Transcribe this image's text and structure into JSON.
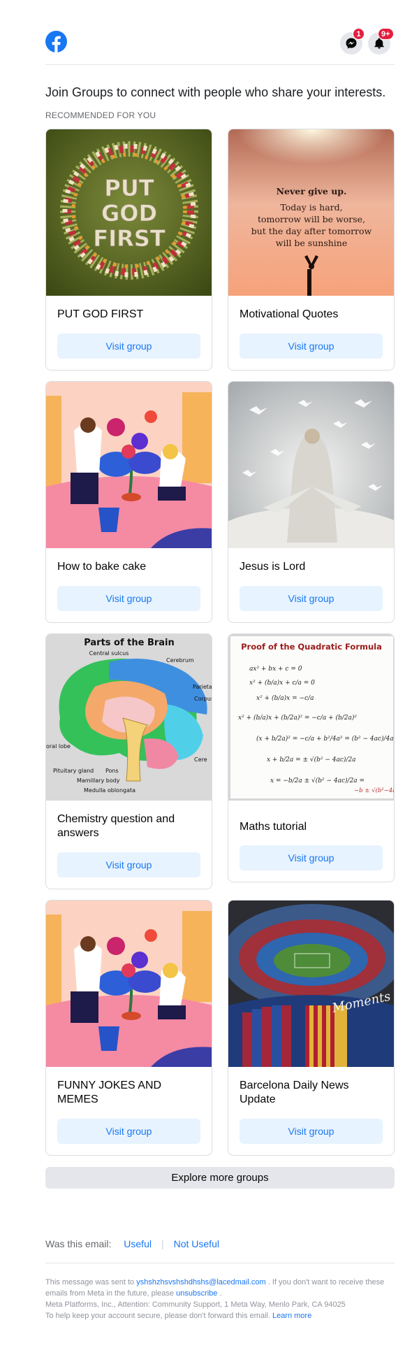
{
  "header": {
    "logo_icon": "facebook-logo-icon",
    "messenger_icon": "messenger-icon",
    "messenger_badge": "1",
    "notifications_icon": "bell-icon",
    "notifications_badge": "9+",
    "brand_color": "#1877f2",
    "badge_color": "#e41e3f"
  },
  "intro": "Join Groups to connect with people who share your interests.",
  "section_label": "RECOMMENDED FOR YOU",
  "groups": [
    {
      "name": "PUT GOD FIRST",
      "button": "Visit group",
      "image_text": [
        "PUT",
        "GOD",
        "FIRST"
      ]
    },
    {
      "name": "Motivational Quotes",
      "button": "Visit group",
      "image_text": [
        "Never give up.",
        "Today is hard,",
        "tomorrow will be worse,",
        "but the day after tomorrow",
        "will be sunshine"
      ]
    },
    {
      "name": "How to bake cake",
      "button": "Visit group"
    },
    {
      "name": "Jesus is Lord",
      "button": "Visit group"
    },
    {
      "name": "Chemistry question and answers",
      "button": "Visit group",
      "image_text": [
        "Parts of the Brain",
        "Central sulcus",
        "Cerebrum",
        "Parietal",
        "Corpus",
        "Pituitary gland",
        "Pons",
        "Mamillary body",
        "Medulla oblongata",
        "oral lobe",
        "Cere"
      ]
    },
    {
      "name": "Maths tutorial",
      "button": "Visit group",
      "image_text": [
        "Proof of the Quadratic Formula"
      ]
    },
    {
      "name": "FUNNY JOKES AND MEMES",
      "button": "Visit group"
    },
    {
      "name": "Barcelona Daily News Update",
      "button": "Visit group",
      "image_text": [
        "Moments"
      ]
    }
  ],
  "explore_button": "Explore more groups",
  "feedback": {
    "question": "Was this email:",
    "useful": "Useful",
    "not_useful": "Not Useful"
  },
  "footer": {
    "line1_pre": "This message was sent to ",
    "email": "yshshzhsvshshdhshs@lacedmail.com",
    "line1_post": " . If you don't want to receive these emails from Meta in the future, please ",
    "unsubscribe": "unsubscribe",
    "line1_end": " .",
    "line2": "Meta Platforms, Inc., Attention: Community Support, 1 Meta Way, Menlo Park, CA 94025",
    "line3_pre": "To help keep your account secure, please don't forward this email. ",
    "learn_more": "Learn more"
  }
}
